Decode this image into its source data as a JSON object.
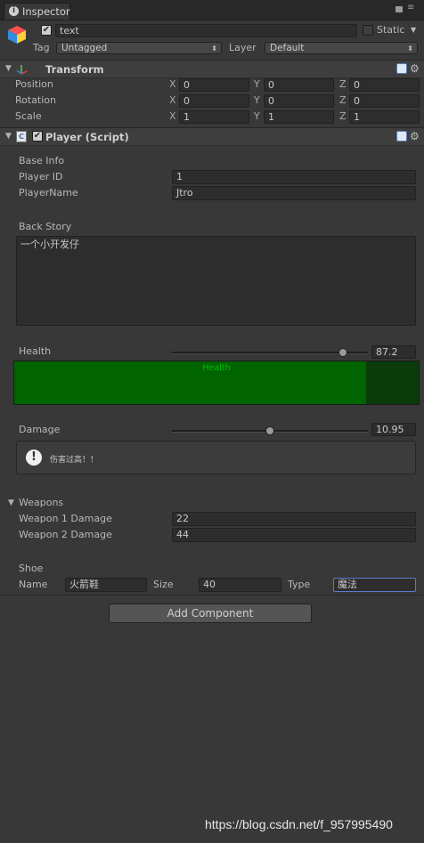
{
  "window": {
    "tab_title": "Inspector"
  },
  "object": {
    "enabled": true,
    "name": "text",
    "static_label": "Static",
    "static_checked": false
  },
  "tag_layer": {
    "tag_label": "Tag",
    "tag_value": "Untagged",
    "layer_label": "Layer",
    "layer_value": "Default"
  },
  "transform": {
    "title": "Transform",
    "rows": [
      {
        "label": "Position",
        "x": "0",
        "y": "0",
        "z": "0"
      },
      {
        "label": "Rotation",
        "x": "0",
        "y": "0",
        "z": "0"
      },
      {
        "label": "Scale",
        "x": "1",
        "y": "1",
        "z": "1"
      }
    ],
    "axis_x": "X",
    "axis_y": "Y",
    "axis_z": "Z"
  },
  "script": {
    "title": "Player (Script)",
    "enabled": true,
    "base_info_header": "Base Info",
    "player_id_label": "Player ID",
    "player_id_value": "1",
    "player_name_label": "PlayerName",
    "player_name_value": "Jtro",
    "back_story_header": "Back Story",
    "back_story_value": "一个小开发仔",
    "health_label": "Health",
    "health_value": "87.2",
    "health_fraction": 0.872,
    "health_bar_label": "Health",
    "health_bar_fraction": 0.87,
    "damage_label": "Damage",
    "damage_value": "10.95",
    "damage_fraction": 0.5,
    "warning_text": "伤害过高！！",
    "weapons_header": "Weapons",
    "weapon1_label": "Weapon 1 Damage",
    "weapon1_value": "22",
    "weapon2_label": "Weapon 2 Damage",
    "weapon2_value": "44",
    "shoe_header": "Shoe",
    "shoe_name_label": "Name",
    "shoe_name_value": "火箭鞋",
    "shoe_size_label": "Size",
    "shoe_size_value": "40",
    "shoe_type_label": "Type",
    "shoe_type_value": "魔法"
  },
  "add_component_label": "Add Component",
  "watermark": "https://blog.csdn.net/f_957995490",
  "colors": {
    "background": "#383838",
    "health_fill": "#006400",
    "health_text": "#00c000",
    "focus_border": "#5b79c7"
  }
}
